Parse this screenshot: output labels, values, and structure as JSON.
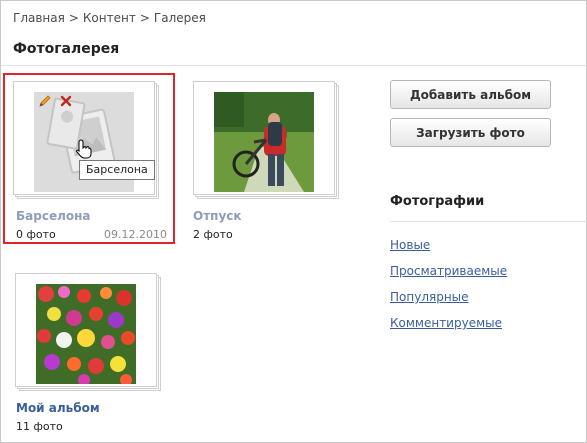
{
  "breadcrumb": {
    "items": [
      "Главная",
      "Контент",
      "Галерея"
    ],
    "separator": ">"
  },
  "page": {
    "title": "Фотогалерея"
  },
  "albums": [
    {
      "name": "Барселона",
      "count": "0 фото",
      "date": "09.12.2010",
      "selected": true,
      "tooltip": "Барселона",
      "name_color": "#8c9dbd"
    },
    {
      "name": "Отпуск",
      "count": "2 фото",
      "name_color": "#8c9dbd"
    },
    {
      "name": "Мой альбом",
      "count": "11 фото",
      "name_color": "#3a5e9c"
    }
  ],
  "actions": {
    "add_album": "Добавить альбом",
    "upload_photo": "Загрузить фото"
  },
  "sidebar": {
    "title": "Фотографии",
    "links": [
      "Новые",
      "Просматриваемые",
      "Популярные",
      "Комментируемые"
    ]
  },
  "colors": {
    "selection_border": "#e0242a",
    "link": "#3a5e9c"
  },
  "icons": [
    "pencil-icon",
    "close-icon",
    "hand-cursor-icon"
  ]
}
